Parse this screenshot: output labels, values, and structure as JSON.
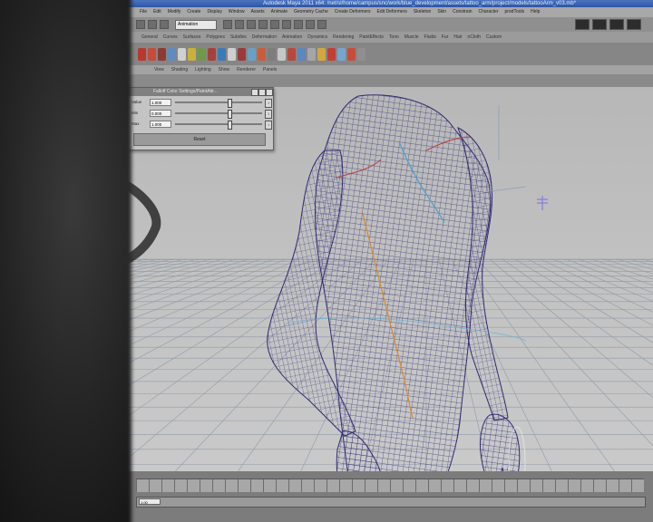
{
  "window": {
    "title": "Autodesk Maya 2011 x64: /net/sl/home/campus/snc/work/blue_development/assets/tattoo_arm/project/models/tattooArm_v03.mb*"
  },
  "menubar": {
    "items": [
      "File",
      "Edit",
      "Modify",
      "Create",
      "Display",
      "Window",
      "Assets",
      "Animate",
      "Geometry Cache",
      "Create Deformers",
      "Edit Deformers",
      "Skeleton",
      "Skin",
      "Constrain",
      "Character",
      "prodTools",
      "Help"
    ]
  },
  "statusline": {
    "mode": "Animation"
  },
  "shelf": {
    "tabs": [
      "General",
      "Curves",
      "Surfaces",
      "Polygons",
      "Subdivs",
      "Deformation",
      "Animation",
      "Dynamics",
      "Rendering",
      "PaintEffects",
      "Toon",
      "Muscle",
      "Fluids",
      "Fur",
      "Hair",
      "nCloth",
      "Custom"
    ],
    "icon_colors": [
      "#b8382e",
      "#c74a3a",
      "#8a3c32",
      "#5e8cc0",
      "#d0d0d0",
      "#c9b13a",
      "#6c9a48",
      "#a6413a",
      "#3d7ab5",
      "#cfcfcf",
      "#9b3a3a",
      "#6aa0c8",
      "#c95d3b",
      "#7d7d7d",
      "#c7c7c7",
      "#b9473b",
      "#5c87bf",
      "#a6a6a6",
      "#d3a640",
      "#c23f35",
      "#7aa4d0",
      "#c94c39",
      "#8f8f8f"
    ]
  },
  "panel": {
    "menus": [
      "View",
      "Shading",
      "Lighting",
      "Show",
      "Renderer",
      "Panels"
    ]
  },
  "dialog": {
    "title": "Falloff Color Settings/PaintAttr...",
    "rows": [
      {
        "label": "Value",
        "value": "1.000",
        "knob": 0.62
      },
      {
        "label": "Min",
        "value": "0.000",
        "knob": 0.62
      },
      {
        "label": "Max",
        "value": "1.000",
        "knob": 0.62
      }
    ],
    "button_label": "Reset"
  },
  "timebar": {
    "start": "1.00"
  },
  "colors": {
    "mesh_wire": "#35307a",
    "grid_line": "#8f9aa8",
    "viewport_bg": "#c2c2c2"
  }
}
